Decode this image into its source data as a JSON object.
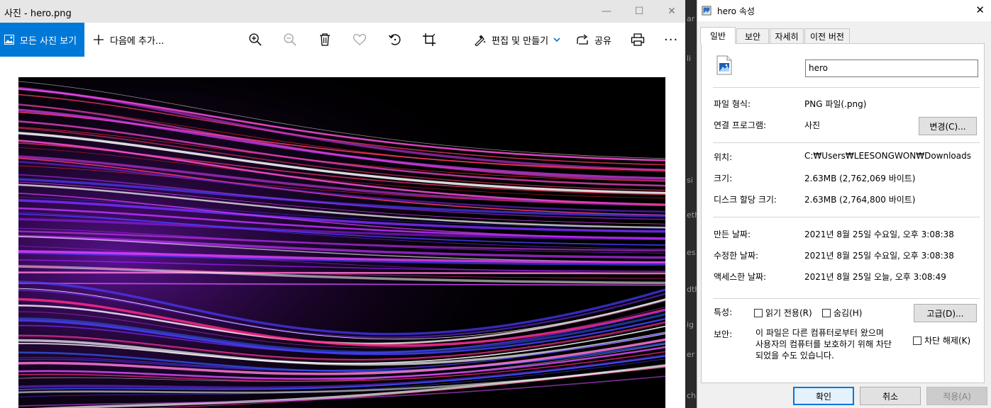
{
  "photos_app": {
    "window_title": "사진 - hero.png",
    "window_controls": {
      "minimize": "—",
      "maximize": "☐",
      "close": "✕"
    },
    "toolbar": {
      "all_photos_label": "모든 사진 보기",
      "add_to_label": "다음에 추가...",
      "edit_create_label": "편집 및 만들기",
      "share_label": "공유",
      "more_label": "···",
      "icons": [
        "zoom-in-icon",
        "zoom-out-icon",
        "delete-icon",
        "favorite-icon",
        "rotate-icon",
        "crop-icon",
        "print-icon"
      ]
    },
    "accent_color": "#0078d7"
  },
  "properties_dialog": {
    "title": "hero 속성",
    "close_glyph": "✕",
    "tabs": [
      "일반",
      "보안",
      "자세히",
      "이전 버전"
    ],
    "active_tab": "일반",
    "file_name": "hero",
    "fields": {
      "type_label": "파일 형식:",
      "type_value": "PNG 파일(.png)",
      "opens_with_label": "연결 프로그램:",
      "opens_with_value": "사진",
      "change_button": "변경(C)...",
      "location_label": "위치:",
      "location_value": "C:₩Users₩LEESONGWON₩Downloads",
      "size_label": "크기:",
      "size_value": "2.63MB (2,762,069 바이트)",
      "size_on_disk_label": "디스크 할당 크기:",
      "size_on_disk_value": "2.63MB (2,764,800 바이트)",
      "created_label": "만든 날짜:",
      "created_value": "2021년 8월 25일 수요일, 오후 3:08:38",
      "modified_label": "수정한 날짜:",
      "modified_value": "2021년 8월 25일 수요일, 오후 3:08:38",
      "accessed_label": "액세스한 날짜:",
      "accessed_value": "2021년 8월 25일 오늘, 오후 3:08:49",
      "attributes_label": "특성:",
      "readonly_label": "읽기 전용(R)",
      "hidden_label": "숨김(H)",
      "advanced_button": "고급(D)...",
      "security_label": "보안:",
      "security_text_lines": [
        "이 파일은 다른 컴퓨터로부터 왔으며",
        "사용자의 컴퓨터를 보호하기 위해 차단",
        "되었을 수도 있습니다."
      ],
      "unblock_label": "차단 해제(K)"
    },
    "buttons": {
      "ok": "확인",
      "cancel": "취소",
      "apply": "적용(A)"
    }
  },
  "background_window_fragments": [
    "ar",
    "li",
    "si",
    "eth",
    "es",
    "dth",
    "ig",
    "er",
    "ch"
  ]
}
